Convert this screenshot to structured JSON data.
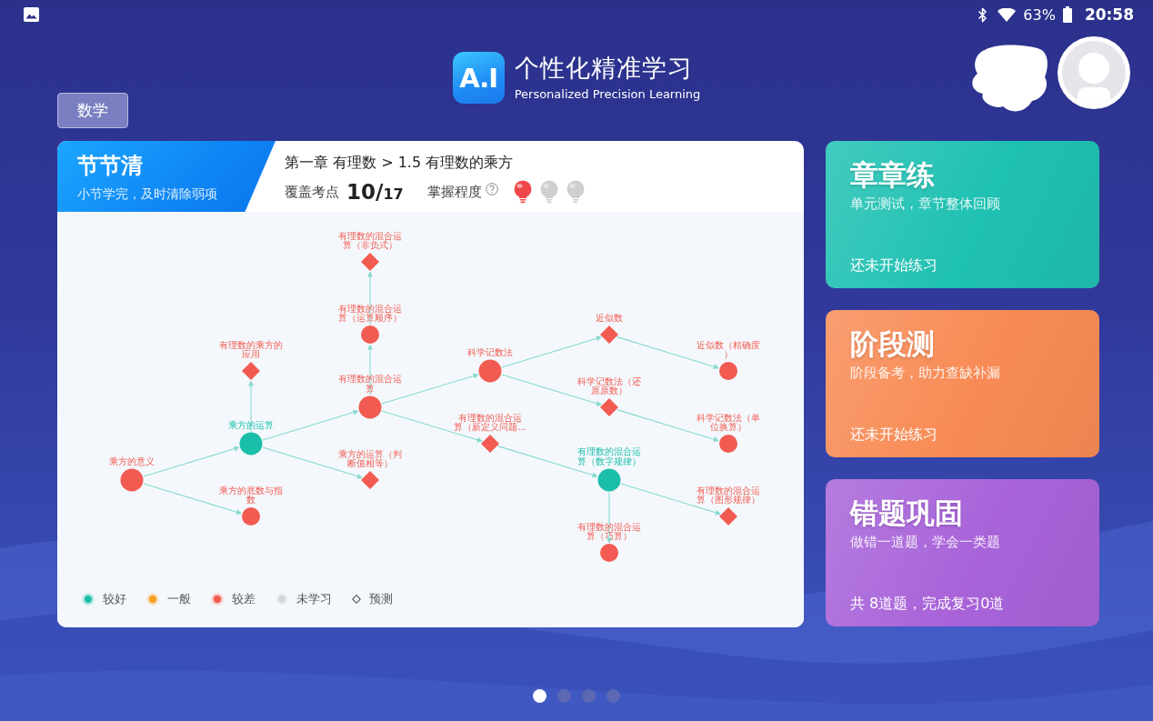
{
  "status_bar": {
    "battery": "63%",
    "time": "20:58"
  },
  "header": {
    "subject_button": "数学",
    "logo_text": "A.I",
    "title": "个性化精准学习",
    "subtitle": "Personalized Precision Learning"
  },
  "lesson_card": {
    "banner": {
      "title": "节节清",
      "subtitle": "小节学完，及时清除弱项"
    },
    "breadcrumb": "第一章 有理数 > 1.5 有理数的乘方",
    "coverage": {
      "label": "覆盖考点",
      "covered": "10/",
      "total": "17"
    },
    "mastery": {
      "label": "掌握程度",
      "stars": 1
    },
    "knowledge_map": {
      "nodes": [
        {
          "label": "乘方的意义",
          "color": "#f25b51",
          "predicted": false,
          "large": true,
          "children": [
            {
              "label": "乘方的运算",
              "color": "#1bbfa9",
              "predicted": false,
              "large": true,
              "children": [
                {
                  "label": "有理数的乘方的应用",
                  "color": "#f25b51",
                  "predicted": true,
                  "large": false
                },
                {
                  "label": "有理数的混合运算",
                  "color": "#f25b51",
                  "predicted": false,
                  "large": true,
                  "children": [
                    {
                      "label": "有理数的混合运算（运算顺序）",
                      "color": "#f25b51",
                      "predicted": false,
                      "large": false,
                      "children": [
                        {
                          "label": "有理数的混合运算（非负式）",
                          "color": "#f25b51",
                          "predicted": true,
                          "large": false
                        }
                      ]
                    },
                    {
                      "label": "科学记数法",
                      "color": "#f25b51",
                      "predicted": false,
                      "large": true,
                      "children": [
                        {
                          "label": "近似数",
                          "color": "#f25b51",
                          "predicted": true,
                          "large": false,
                          "children": [
                            {
                              "label": "近似数（精确度）",
                              "color": "#f25b51",
                              "predicted": false,
                              "large": false
                            }
                          ]
                        },
                        {
                          "label": "科学记数法（还原原数）",
                          "color": "#f25b51",
                          "predicted": true,
                          "large": false,
                          "children": [
                            {
                              "label": "科学记数法（单位换算）",
                              "color": "#f25b51",
                              "predicted": false,
                              "large": false
                            }
                          ]
                        }
                      ]
                    },
                    {
                      "label": "有理数的混合运算（新定义问题...",
                      "color": "#f25b51",
                      "predicted": true,
                      "large": false,
                      "children": [
                        {
                          "label": "有理数的混合运算（数字规律）",
                          "color": "#1bbfa9",
                          "predicted": false,
                          "large": true,
                          "children": [
                            {
                              "label": "有理数的混合运算（巧算）",
                              "color": "#f25b51",
                              "predicted": false,
                              "large": false
                            },
                            {
                              "label": "有理数的混合运算（图形规律）",
                              "color": "#f25b51",
                              "predicted": true,
                              "large": false
                            }
                          ]
                        }
                      ]
                    }
                  ]
                },
                {
                  "label": "乘方的运算（判断值相等）",
                  "color": "#f25b51",
                  "predicted": true,
                  "large": false
                }
              ]
            },
            {
              "label": "乘方的底数与指数",
              "color": "#f25b51",
              "predicted": false,
              "large": false
            }
          ]
        }
      ]
    },
    "legend": [
      {
        "kind": "dot",
        "label": "较好",
        "color": "#1bbfa9"
      },
      {
        "kind": "dot",
        "label": "一般",
        "color": "#f6a020"
      },
      {
        "kind": "dot",
        "label": "较差",
        "color": "#f25b51"
      },
      {
        "kind": "dot",
        "label": "未学习",
        "color": "#d3d6dc"
      },
      {
        "kind": "diamond",
        "label": "预测"
      }
    ]
  },
  "practice_cards": [
    {
      "title": "章章练",
      "subtitle": "单元测试，章节整体回顾",
      "footer": "还未开始练习",
      "color": "#1fc1b2"
    },
    {
      "title": "阶段测",
      "subtitle": "阶段备考，助力查缺补漏",
      "footer": "还未开始练习",
      "color": "#f88b55"
    },
    {
      "title": "错题巩固",
      "subtitle": "做错一道题，学会一类题",
      "footer": "共 8道题，完成复习0道",
      "color": "#a863d9"
    }
  ],
  "pagination": [
    {
      "selected": true
    },
    {
      "selected": false
    },
    {
      "selected": false
    },
    {
      "selected": false
    }
  ]
}
